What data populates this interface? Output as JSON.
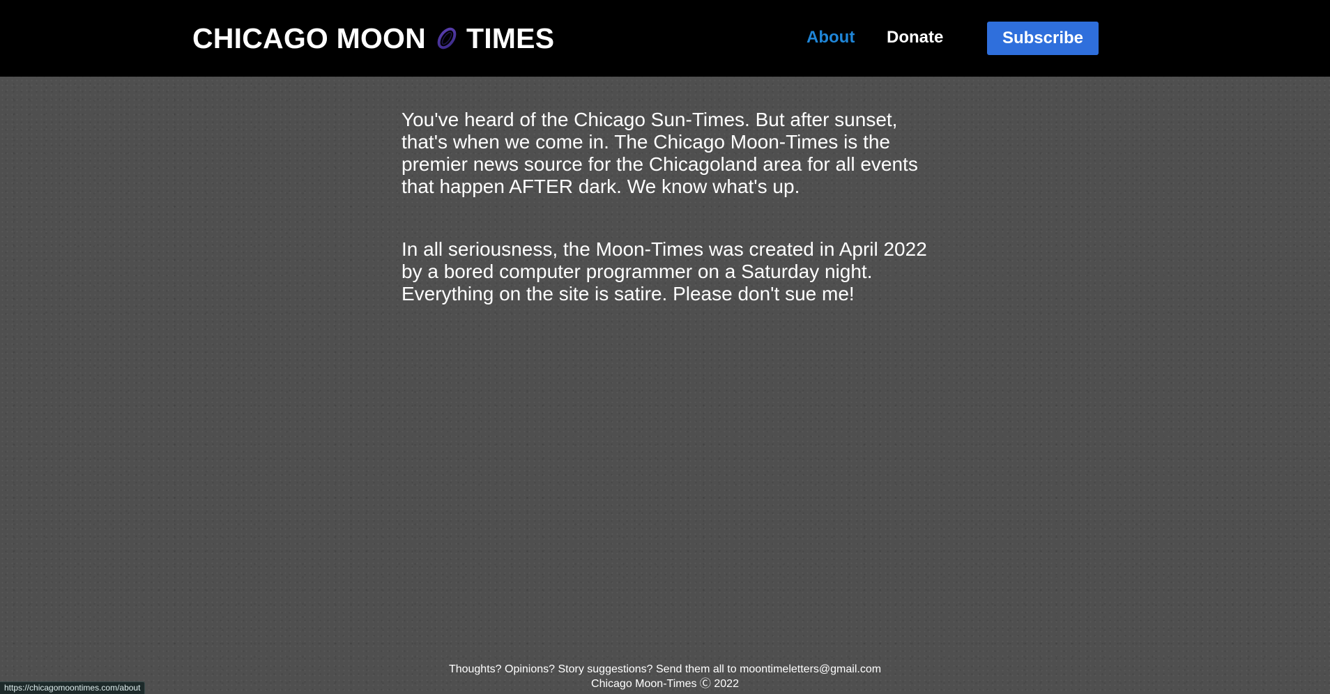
{
  "header": {
    "logo_left": "CHICAGO MOON",
    "logo_right": "TIMES",
    "logo_icon": "moon-planet-icon",
    "nav": {
      "about": "About",
      "donate": "Donate",
      "subscribe": "Subscribe"
    },
    "colors": {
      "active_nav": "#1f86d8",
      "subscribe_bg": "#2f6fdc",
      "header_bg": "#000000"
    }
  },
  "main": {
    "paragraphs": [
      "You've heard of the Chicago Sun-Times. But after sunset, that's when we come in. The Chicago Moon-Times is the premier news source for the Chicagoland area for all events that happen AFTER dark. We know what's up.",
      "In all seriousness, the Moon-Times was created in April 2022 by a bored computer programmer on a Saturday night. Everything on the site is satire. Please don't sue me!"
    ]
  },
  "footer": {
    "line1": "Thoughts? Opinions? Story suggestions? Send them all to moontimeletters@gmail.com",
    "line2": "Chicago Moon-Times Ⓒ 2022"
  },
  "status_bar": {
    "url": "https://chicagomoontimes.com/about"
  }
}
